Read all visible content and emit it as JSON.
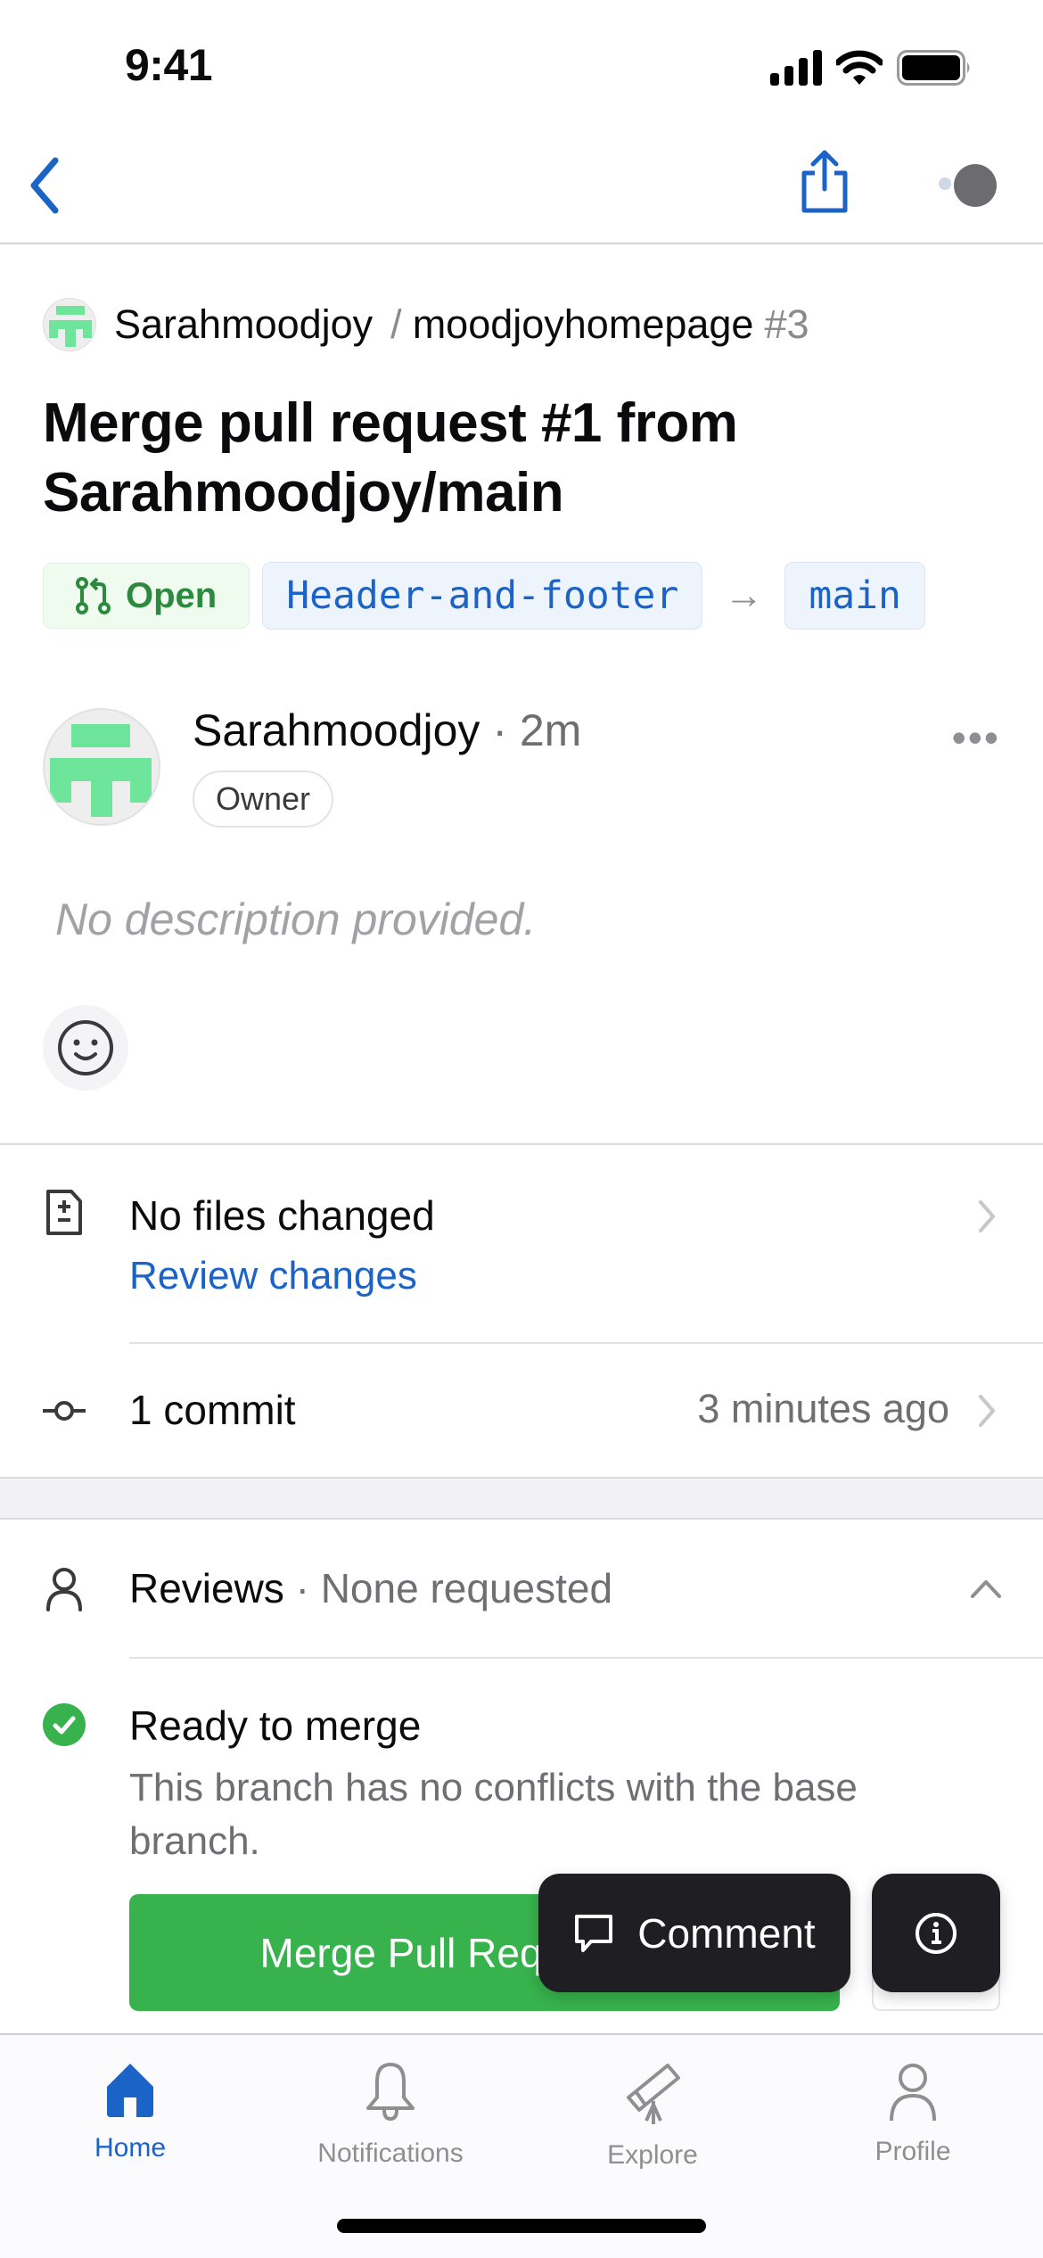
{
  "status_bar": {
    "time": "9:41"
  },
  "nav": {
    "back_icon": "chevron-left-icon",
    "share_icon": "share-icon",
    "more_icon": "more-circle-icon"
  },
  "repo": {
    "owner": "Sarahmoodjoy",
    "separator": "/",
    "name": "moodjoyhomepage",
    "number": "#3"
  },
  "pull_request": {
    "title": "Merge pull request #1 from Sarahmoodjoy/main",
    "state": "Open",
    "head_branch": "Header-and-footer",
    "arrow": "→",
    "base_branch": "main"
  },
  "author": {
    "name": "Sarahmoodjoy",
    "time": "· 2m",
    "role_badge": "Owner",
    "more": "•••"
  },
  "body": {
    "description": "No description provided."
  },
  "files": {
    "title": "No files changed",
    "link": "Review changes"
  },
  "commits": {
    "title": "1 commit",
    "time": "3 minutes ago"
  },
  "reviews": {
    "label": "Reviews",
    "status": "· None requested"
  },
  "merge": {
    "title": "Ready to merge",
    "description": "This branch has no conflicts with the base branch.",
    "button_label": "Merge Pull Request"
  },
  "floating": {
    "comment_label": "Comment",
    "info_icon": "info-icon"
  },
  "tabbar": {
    "items": [
      {
        "label": "Home",
        "icon": "home-icon",
        "active": true
      },
      {
        "label": "Notifications",
        "icon": "bell-icon",
        "active": false
      },
      {
        "label": "Explore",
        "icon": "telescope-icon",
        "active": false
      },
      {
        "label": "Profile",
        "icon": "person-icon",
        "active": false
      }
    ]
  },
  "colors": {
    "accent": "#1b63c6",
    "open_green": "#2b8a3e",
    "merge_green": "#37b24d",
    "avatar_green": "#6ee59a",
    "fab_dark": "#1f1f23"
  }
}
